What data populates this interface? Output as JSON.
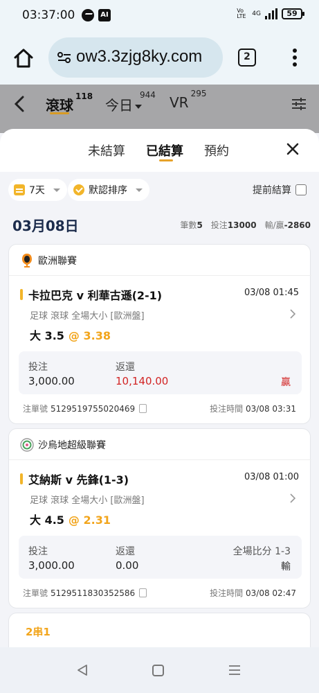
{
  "status_bar": {
    "time": "03:37:00",
    "ai_badge": "AI",
    "volte": "Vo LTE",
    "network": "4G",
    "battery": "59",
    "icons": [
      "messenger-icon",
      "ai-icon",
      "volte-icon",
      "signal-icon",
      "battery-icon"
    ]
  },
  "browser": {
    "url": "ow3.3zjg8ky.com",
    "tab_count": "2",
    "icons": [
      "home-icon",
      "site-settings-icon",
      "tabs-icon",
      "more-menu-icon"
    ]
  },
  "header": {
    "tabs": [
      {
        "label": "滾球",
        "count": "118"
      },
      {
        "label": "今日",
        "count": "944"
      },
      {
        "label": "VR",
        "count": "295"
      }
    ]
  },
  "sheet": {
    "segments": [
      "未結算",
      "已結算",
      "預約"
    ],
    "active_segment": "已結算",
    "filters": {
      "period": "7天",
      "sort": "默認排序",
      "early_settle_label": "提前結算"
    },
    "date": "03月08日",
    "summary": {
      "count_label": "筆數",
      "count": "5",
      "stake_label": "投注",
      "stake": "13000",
      "pnl_label": "輸/贏",
      "pnl": "-2860"
    }
  },
  "bets": [
    {
      "league": "歐洲聯賽",
      "match": "卡拉巴克 v 利華古遜(2-1)",
      "match_time": "03/08 01:45",
      "bet_type": "足球  滾球  全場大小  [歐洲盤]",
      "selection": "大 3.5",
      "odds": "@ 3.38",
      "stake_label": "投注",
      "stake": "3,000.00",
      "return_label": "返還",
      "return": "10,140.00",
      "score_label": "",
      "result": "贏",
      "ticket_label": "注單號",
      "ticket_no": "5129519755020469",
      "bet_time_label": "投注時間",
      "bet_time": "03/08 03:31"
    },
    {
      "league": "沙烏地超級聯賽",
      "match": "艾納斯 v 先鋒(1-3)",
      "match_time": "03/08 01:00",
      "bet_type": "足球  滾球  全場大小  [歐洲盤]",
      "selection": "大 4.5",
      "odds": "@ 2.31",
      "stake_label": "投注",
      "stake": "3,000.00",
      "return_label": "返還",
      "return": "0.00",
      "score_label": "全場比分 1-3",
      "result": "輸",
      "ticket_label": "注單號",
      "ticket_no": "5129511830352586",
      "bet_time_label": "投注時間",
      "bet_time": "03/08 02:47"
    }
  ],
  "parlay_card": {
    "label": "2串1"
  },
  "colors": {
    "accent": "#f2a51c",
    "win": "#d22424",
    "dim_header": "#a6a6a8"
  }
}
